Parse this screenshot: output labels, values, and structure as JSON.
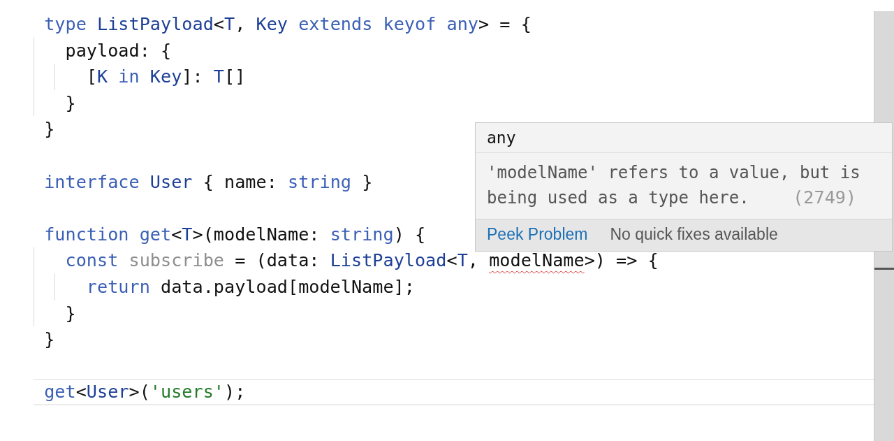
{
  "editor": {
    "lines": [
      {
        "tokens": [
          {
            "text": "type ",
            "kind": "keyword"
          },
          {
            "text": "ListPayload",
            "kind": "type"
          },
          {
            "text": "<",
            "kind": "plain"
          },
          {
            "text": "T",
            "kind": "type"
          },
          {
            "text": ", ",
            "kind": "plain"
          },
          {
            "text": "Key ",
            "kind": "type"
          },
          {
            "text": "extends keyof any",
            "kind": "keyword"
          },
          {
            "text": "> = {",
            "kind": "plain"
          }
        ]
      },
      {
        "tokens": [
          {
            "text": "  payload: {",
            "kind": "plain"
          }
        ]
      },
      {
        "tokens": [
          {
            "text": "    [",
            "kind": "plain"
          },
          {
            "text": "K ",
            "kind": "type"
          },
          {
            "text": "in ",
            "kind": "keyword"
          },
          {
            "text": "Key",
            "kind": "type"
          },
          {
            "text": "]: ",
            "kind": "plain"
          },
          {
            "text": "T",
            "kind": "type"
          },
          {
            "text": "[]",
            "kind": "plain"
          }
        ]
      },
      {
        "tokens": [
          {
            "text": "  }",
            "kind": "plain"
          }
        ]
      },
      {
        "tokens": [
          {
            "text": "}",
            "kind": "plain"
          }
        ]
      },
      {
        "blank_before": true,
        "tokens": [
          {
            "text": "interface ",
            "kind": "keyword"
          },
          {
            "text": "User",
            "kind": "type"
          },
          {
            "text": " { name: ",
            "kind": "plain"
          },
          {
            "text": "string",
            "kind": "keyword"
          },
          {
            "text": " }",
            "kind": "plain"
          }
        ]
      },
      {
        "blank_before": true,
        "tokens": [
          {
            "text": "function get",
            "kind": "keyword"
          },
          {
            "text": "<",
            "kind": "plain"
          },
          {
            "text": "T",
            "kind": "type"
          },
          {
            "text": ">(modelName: ",
            "kind": "plain"
          },
          {
            "text": "string",
            "kind": "keyword"
          },
          {
            "text": ") {",
            "kind": "plain"
          }
        ]
      },
      {
        "tokens": [
          {
            "text": "  const ",
            "kind": "keyword"
          },
          {
            "text": "subscribe",
            "kind": "unused"
          },
          {
            "text": " = (data: ",
            "kind": "plain"
          },
          {
            "text": "ListPayload",
            "kind": "type"
          },
          {
            "text": "<",
            "kind": "plain"
          },
          {
            "text": "T",
            "kind": "type"
          },
          {
            "text": ", ",
            "kind": "plain"
          },
          {
            "text": "modelName",
            "kind": "error"
          },
          {
            "text": ">) => {",
            "kind": "plain"
          }
        ]
      },
      {
        "tokens": [
          {
            "text": "    return",
            "kind": "keyword"
          },
          {
            "text": " data.payload[modelName];",
            "kind": "plain"
          }
        ]
      },
      {
        "tokens": [
          {
            "text": "  }",
            "kind": "plain"
          }
        ]
      },
      {
        "tokens": [
          {
            "text": "}",
            "kind": "plain"
          }
        ]
      },
      {
        "blank_before": true,
        "current": true,
        "tokens": [
          {
            "text": "get",
            "kind": "keyword"
          },
          {
            "text": "<",
            "kind": "plain"
          },
          {
            "text": "User",
            "kind": "type"
          },
          {
            "text": ">(",
            "kind": "plain"
          },
          {
            "text": "'users'",
            "kind": "string"
          },
          {
            "text": ");",
            "kind": "plain"
          }
        ]
      }
    ]
  },
  "hover": {
    "type": "any",
    "message": "'modelName' refers to a value, but is being used as a type here.",
    "code": "(2749)",
    "link": "Peek Problem",
    "note": "No quick fixes available"
  }
}
